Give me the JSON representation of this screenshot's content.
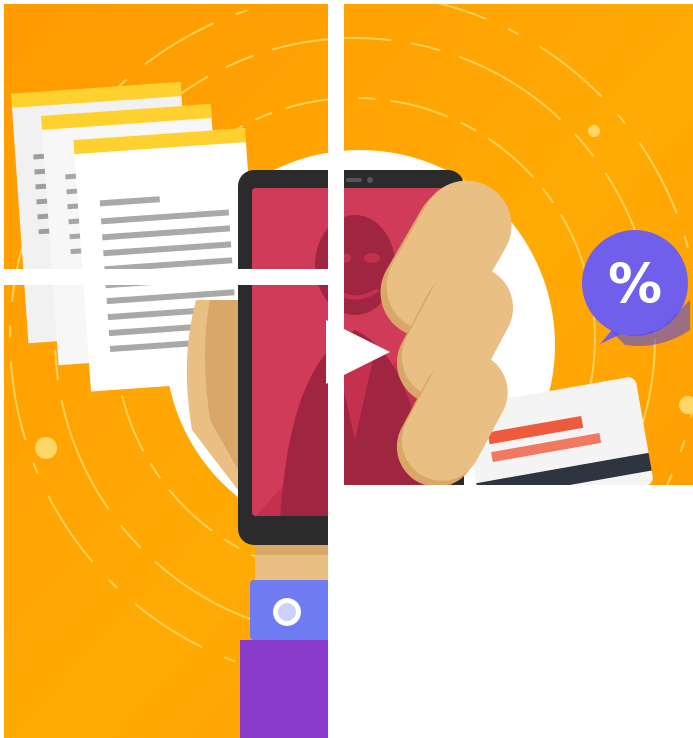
{
  "illustration": {
    "play_icon": "play-icon",
    "badge_symbol": "%",
    "badge_icon": "percent-badge-icon"
  },
  "colors": {
    "orange_light": "#FFB000",
    "orange_dark": "#FF9500",
    "white": "#FFFFFF",
    "paper_yellow": "#FFD12E",
    "screen_red": "#D13758",
    "skin": "#E9BF83",
    "skin_shadow": "#D9A868",
    "phone_dark": "#2B2B2B",
    "badge_purple": "#6F5FEA",
    "sleeve_purple": "#8A3BC9",
    "cuff_blue": "#6E7BF2",
    "card_white": "#F4F4F4",
    "card_red": "#F05A3C",
    "card_stripe": "#2E3440"
  }
}
